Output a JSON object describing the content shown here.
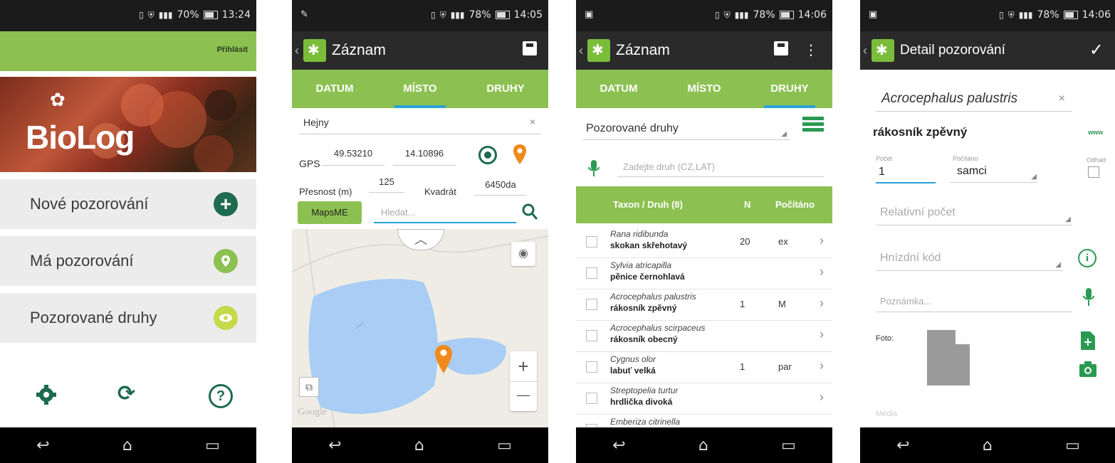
{
  "phone1": {
    "status_time": "13:24",
    "status_battery": "70%",
    "login_label": "Přihlásit",
    "brand": "BioLog",
    "menu": [
      {
        "label": "Nové pozorování",
        "icon": "plus-icon",
        "color": "#1e6b4f"
      },
      {
        "label": "Má pozorování",
        "icon": "location-pin-icon",
        "color": "#8cc152"
      },
      {
        "label": "Pozorované druhy",
        "icon": "eye-icon",
        "color": "#c5da4a"
      }
    ]
  },
  "phone2": {
    "status_time": "14:05",
    "status_battery": "78%",
    "title": "Záznam",
    "tabs": [
      "DATUM",
      "MÍSTO",
      "DRUHY"
    ],
    "active_tab": "MÍSTO",
    "place_value": "Hejny",
    "gps_label": "GPS",
    "gps_lat": "49.53210",
    "gps_lon": "14.10896",
    "accuracy_label": "Přesnost (m)",
    "accuracy_value": "125",
    "quadrant_label": "Kvadrát",
    "quadrant_value": "6450da",
    "mapsme_label": "MapsME",
    "search_placeholder": "Hledat...",
    "map_watermark": "Google",
    "zoom_in": "+",
    "zoom_out": "—"
  },
  "phone3": {
    "status_time": "14:06",
    "status_battery": "78%",
    "title": "Záznam",
    "tabs": [
      "DATUM",
      "MÍSTO",
      "DRUHY"
    ],
    "active_tab": "DRUHY",
    "filter_value": "Pozorované druhy",
    "species_placeholder": "Zadejte druh (CZ,LAT)",
    "table_headers": [
      "Taxon / Druh (8)",
      "N",
      "Počítáno"
    ],
    "rows": [
      {
        "latin": "Rana ridibunda",
        "czech": "skokan skřehotavý",
        "n": "20",
        "counted": "ex"
      },
      {
        "latin": "Sylvia atricapilla",
        "czech": "pěnice černohlavá",
        "n": "",
        "counted": ""
      },
      {
        "latin": "Acrocephalus palustris",
        "czech": "rákosník zpěvný",
        "n": "1",
        "counted": "M"
      },
      {
        "latin": "Acrocephalus scirpaceus",
        "czech": "rákosník obecný",
        "n": "",
        "counted": ""
      },
      {
        "latin": "Cygnus olor",
        "czech": "labuť velká",
        "n": "1",
        "counted": "par"
      },
      {
        "latin": "Streptopelia turtur",
        "czech": "hrdlička divoká",
        "n": "",
        "counted": ""
      },
      {
        "latin": "Emberiza citrinella",
        "czech": "",
        "n": "",
        "counted": ""
      }
    ]
  },
  "phone4": {
    "status_time": "14:06",
    "status_battery": "78%",
    "title": "Detail pozorování",
    "species_latin": "Acrocephalus palustris",
    "species_czech": "rákosník zpěvný",
    "www_label": "www",
    "count_label": "Počet",
    "count_value": "1",
    "counted_label": "Počítáno",
    "counted_value": "samci",
    "estimate_label": "Odhad",
    "relative_placeholder": "Relativní počet",
    "nest_placeholder": "Hnízdní kód",
    "note_placeholder": "Poznámka...",
    "photo_label": "Foto:",
    "media_label": "Média"
  }
}
